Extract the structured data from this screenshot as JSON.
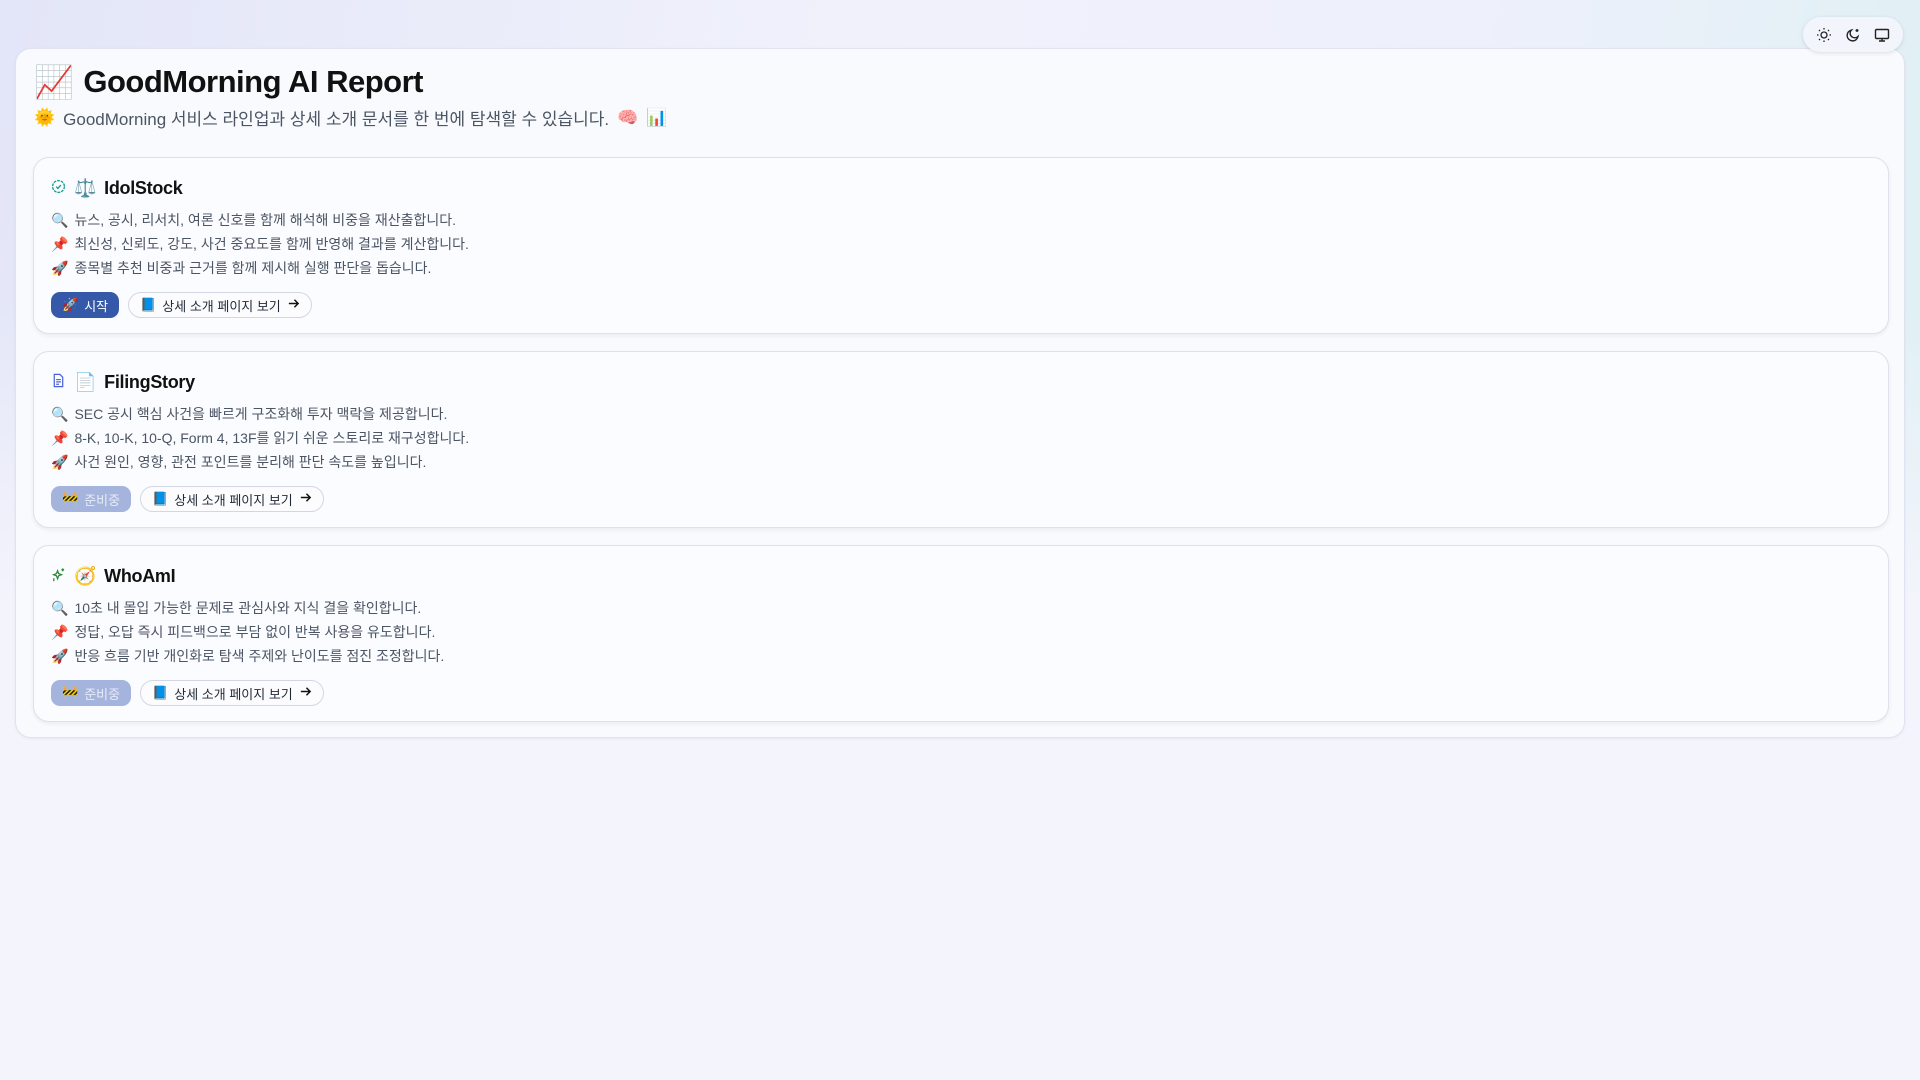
{
  "header": {
    "title_emoji": "📈",
    "title": "GoodMorning AI Report",
    "subtitle_lead_emoji": "🌞",
    "subtitle": "GoodMorning 서비스 라인업과 상세 소개 문서를 한 번에 탐색할 수 있습니다.",
    "subtitle_trail_emojis": [
      "🧠",
      "📊"
    ]
  },
  "theme_toggle": [
    "light",
    "dark",
    "system"
  ],
  "detail_label": "상세 소개 페이지 보기",
  "detail_emoji": "📘",
  "cards": [
    {
      "name": "IdolStock",
      "emoji": "⚖️",
      "status": "시작",
      "status_emoji": "🚀",
      "bullets": [
        {
          "emoji": "🔍",
          "text": "뉴스, 공시, 리서치, 여론 신호를 함께 해석해 비중을 재산출합니다."
        },
        {
          "emoji": "📌",
          "text": "최신성, 신뢰도, 강도, 사건 중요도를 함께 반영해 결과를 계산합니다."
        },
        {
          "emoji": "🚀",
          "text": "종목별 추천 비중과 근거를 함께 제시해 실행 판단을 돕습니다."
        }
      ]
    },
    {
      "name": "FilingStory",
      "emoji": "📄",
      "status": "준비중",
      "status_emoji": "🚧",
      "bullets": [
        {
          "emoji": "🔍",
          "text": "SEC 공시 핵심 사건을 빠르게 구조화해 투자 맥락을 제공합니다."
        },
        {
          "emoji": "📌",
          "text": "8-K, 10-K, 10-Q, Form 4, 13F를 읽기 쉬운 스토리로 재구성합니다."
        },
        {
          "emoji": "🚀",
          "text": "사건 원인, 영향, 관전 포인트를 분리해 판단 속도를 높입니다."
        }
      ]
    },
    {
      "name": "WhoAmI",
      "emoji": "🧭",
      "status": "준비중",
      "status_emoji": "🚧",
      "bullets": [
        {
          "emoji": "🔍",
          "text": "10초 내 몰입 가능한 문제로 관심사와 지식 결을 확인합니다."
        },
        {
          "emoji": "📌",
          "text": "정답, 오답 즉시 피드백으로 부담 없이 반복 사용을 유도합니다."
        },
        {
          "emoji": "🚀",
          "text": "반응 흐름 기반 개인화로 탐색 주제와 난이도를 점진 조정합니다."
        }
      ]
    }
  ]
}
